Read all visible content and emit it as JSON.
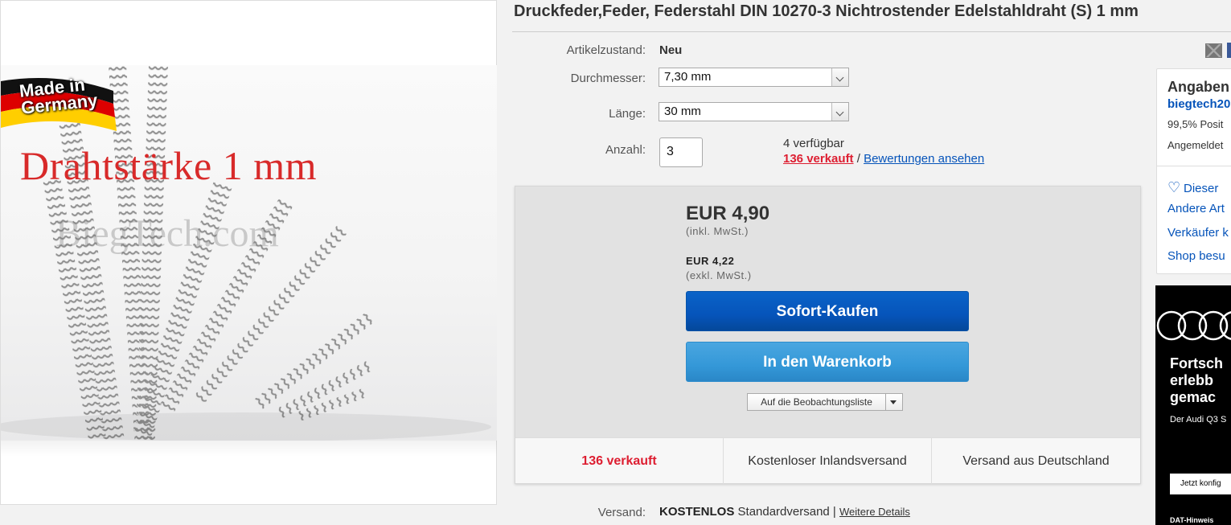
{
  "product": {
    "title": "Druckfeder,Feder, Federstahl DIN 10270-3 Nichtrostender Edelstahldraht (S) 1 mm",
    "image": {
      "badge_text_line1": "Made in",
      "badge_text_line2": "Germany",
      "caption": "Drahtstärke 1 mm",
      "watermark": "BiegTech.com"
    }
  },
  "details": {
    "condition_label": "Artikelzustand:",
    "condition_value": "Neu",
    "diameter_label": "Durchmesser:",
    "diameter_value": "7,30 mm",
    "length_label": "Länge:",
    "length_value": "30 mm",
    "quantity_label": "Anzahl:",
    "quantity_value": "3",
    "available": "4 verfügbar",
    "sold_link": "136 verkauft",
    "separator": "/",
    "reviews_link": "Bewertungen ansehen"
  },
  "buybox": {
    "price": "EUR 4,90",
    "price_note": "(inkl. MwSt.)",
    "price_net": "EUR 4,22",
    "price_net_note": "(exkl. MwSt.)",
    "buy_now": "Sofort-Kaufen",
    "add_to_cart": "In den Warenkorb",
    "watchlist": "Auf die Beobachtungsliste"
  },
  "stats": {
    "sold": "136 verkauft",
    "free_shipping": "Kostenloser Inlandsversand",
    "ships_from": "Versand aus Deutschland"
  },
  "shipping": {
    "label": "Versand:",
    "price": "KOSTENLOS",
    "method": "Standardversand |",
    "details_link": "Weitere Details"
  },
  "seller": {
    "heading": "Angaben",
    "name": "biegtech20",
    "positive": "99,5% Posit",
    "registered": "Angemeldet",
    "save": "Dieser",
    "other_items": "Andere Art",
    "contact": "Verkäufer k",
    "visit_shop": "Shop besu"
  },
  "ad": {
    "title_line1": "Fortsch",
    "title_line2": "erlebb",
    "title_line3": "gemac",
    "subtitle": "Der Audi Q3 S",
    "cta": "Jetzt konfig",
    "footer": "DAT-Hinweis"
  },
  "colors": {
    "accent_blue": "#0654ba",
    "buy_button": "#0654ba",
    "cart_button": "#3498d8",
    "sold_red": "#dd1e31",
    "caption_red": "#d82a2a"
  }
}
